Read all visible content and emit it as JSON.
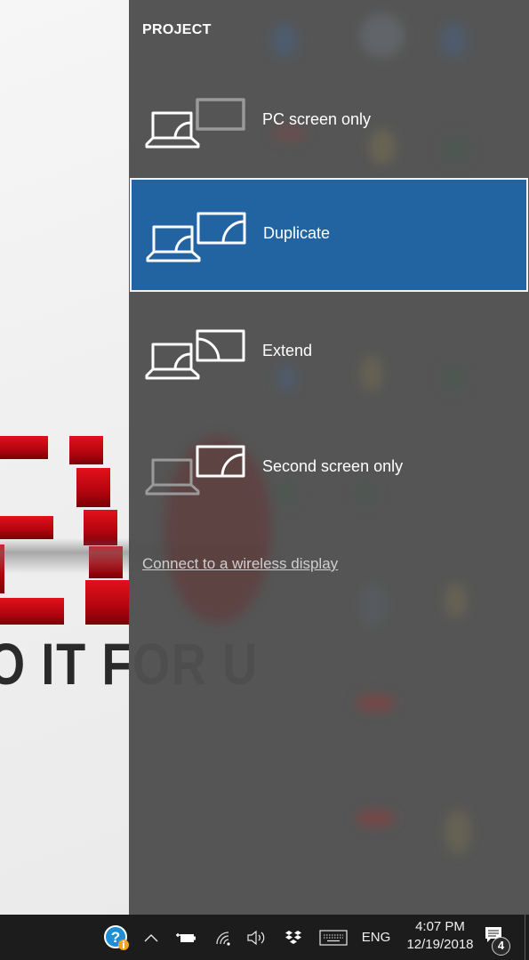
{
  "flyout": {
    "title": "PROJECT",
    "options": [
      {
        "label": "PC screen only",
        "icon": "pc-screen-only-icon",
        "selected": false
      },
      {
        "label": "Duplicate",
        "icon": "duplicate-icon",
        "selected": true
      },
      {
        "label": "Extend",
        "icon": "extend-icon",
        "selected": false
      },
      {
        "label": "Second screen only",
        "icon": "second-screen-only-icon",
        "selected": false
      }
    ],
    "wireless_link": "Connect to a wireless display",
    "colors": {
      "panel": "#4f4f4f",
      "selected": "#2264a2",
      "selected_border": "#f2f2f2"
    }
  },
  "wallpaper": {
    "tagline": "O IT FOR U",
    "accent_color": "#d10a15"
  },
  "taskbar": {
    "tray": [
      {
        "name": "help-info-icon"
      },
      {
        "name": "show-hidden-icons-chevron"
      },
      {
        "name": "battery-charging-icon"
      },
      {
        "name": "wifi-icon"
      },
      {
        "name": "volume-icon"
      },
      {
        "name": "dropbox-icon"
      },
      {
        "name": "touch-keyboard-icon"
      }
    ],
    "language": "ENG",
    "time": "4:07 PM",
    "date": "12/19/2018",
    "notification_count": "4"
  }
}
